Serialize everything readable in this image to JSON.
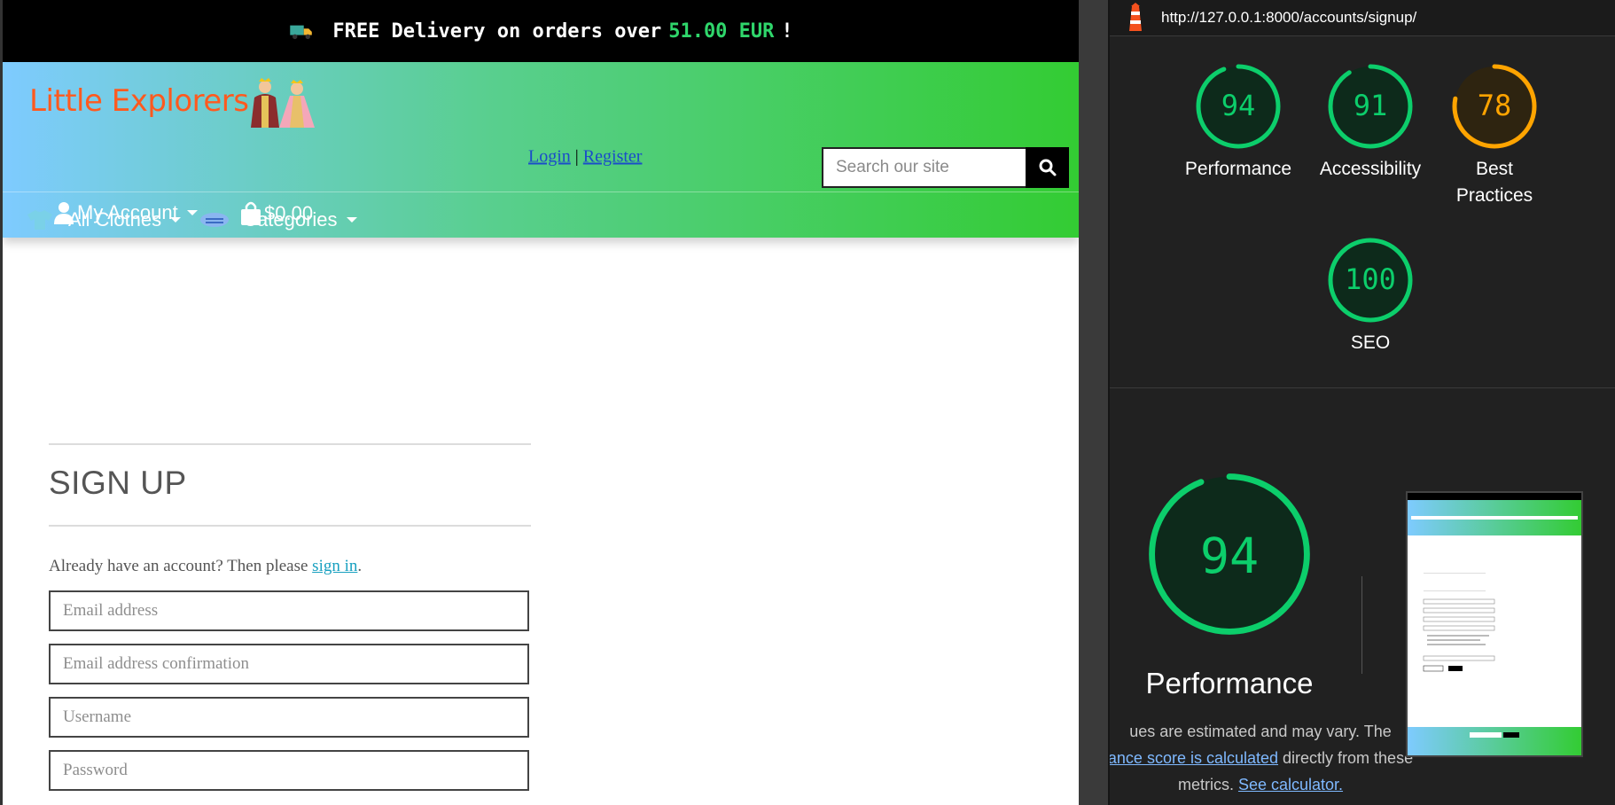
{
  "banner": {
    "prefix": "FREE Delivery on orders over",
    "amount": "51.00 EUR",
    "suffix": "!"
  },
  "header": {
    "logo": "Little Explorers",
    "login_label": "Login",
    "divider": "|",
    "register_label": "Register",
    "search_placeholder": "Search our site",
    "account_label": "My Account",
    "bag_total": "$0.00"
  },
  "nav": {
    "items": [
      {
        "label": "All Clothes"
      },
      {
        "label": "Categories"
      }
    ]
  },
  "signup": {
    "title": "SIGN UP",
    "lead_text": "Already have an account? Then please",
    "lead_link": "sign in",
    "lead_end": ".",
    "fields": [
      {
        "placeholder": "Email address"
      },
      {
        "placeholder": "Email address confirmation"
      },
      {
        "placeholder": "Username"
      },
      {
        "placeholder": "Password"
      }
    ]
  },
  "lighthouse": {
    "url": "http://127.0.0.1:8000/accounts/signup/",
    "scores": [
      {
        "label": "Performance",
        "value": 94,
        "color": "#0cce6b"
      },
      {
        "label": "Accessibility",
        "value": 91,
        "color": "#0cce6b"
      },
      {
        "label": "Best Practices",
        "value": 78,
        "color": "#ffa400"
      },
      {
        "label": "SEO",
        "value": 100,
        "color": "#0cce6b"
      }
    ],
    "performance_title": "Performance",
    "note_part1": "ues are estimated and may vary. The",
    "note_link1": "ance score is calculated",
    "note_part2": "directly from these",
    "note_part3": "metrics.",
    "note_link2": "See calculator."
  }
}
